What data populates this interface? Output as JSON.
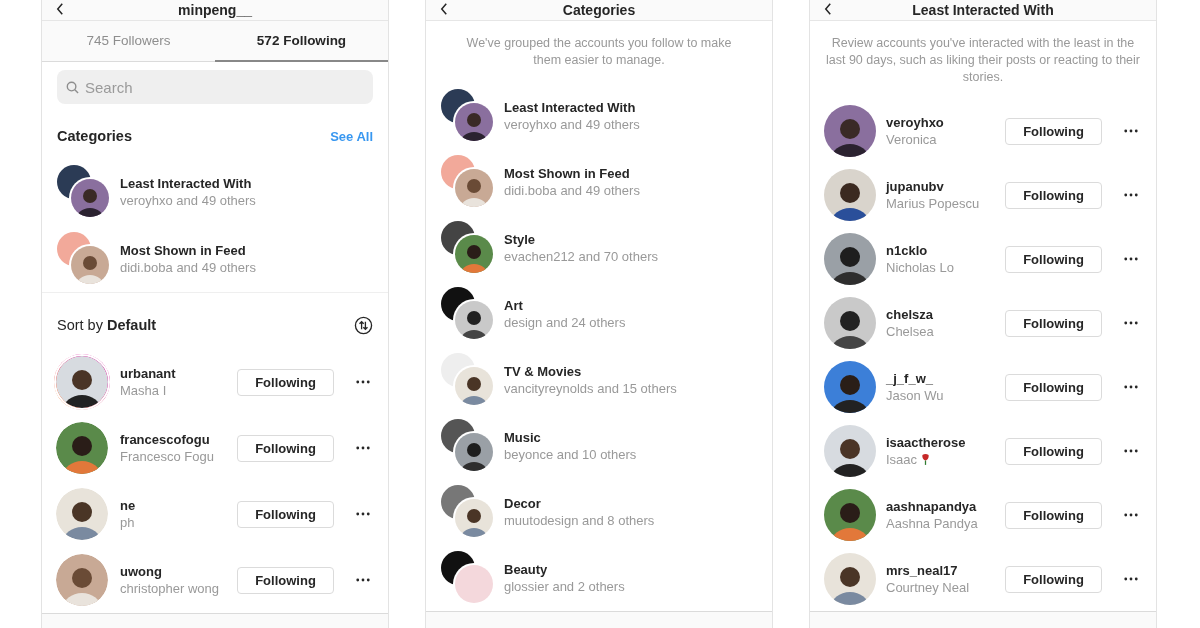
{
  "following_screen": {
    "title": "minpeng__",
    "tabs": [
      {
        "label": "745 Followers",
        "selected": false
      },
      {
        "label": "572 Following",
        "selected": true
      }
    ],
    "search": {
      "placeholder": "Search"
    },
    "categories_title": "Categories",
    "see_all": "See All",
    "categories": [
      {
        "name": "Least Interacted With",
        "summary": "veroyhxo and 49 others"
      },
      {
        "name": "Most Shown in Feed",
        "summary": "didi.boba and 49 others"
      }
    ],
    "sort_label": "Sort by **Default**",
    "accounts": [
      {
        "username": "urbanant",
        "name": "Masha I",
        "story": true,
        "button": "Following"
      },
      {
        "username": "francescofogu",
        "name": "Francesco Fogu",
        "story": false,
        "button": "Following"
      },
      {
        "username": "ne",
        "name": "ph",
        "story": false,
        "button": "Following"
      },
      {
        "username": "uwong",
        "name": "christopher wong",
        "story": false,
        "button": "Following"
      }
    ]
  },
  "categories_screen": {
    "title": "Categories",
    "description": "We've grouped the accounts you follow to make them easier to manage.",
    "categories": [
      {
        "name": "Least Interacted With",
        "summary": "veroyhxo and 49 others"
      },
      {
        "name": "Most Shown in Feed",
        "summary": "didi.boba and 49 others"
      },
      {
        "name": "Style",
        "summary": "evachen212 and 70 others"
      },
      {
        "name": "Art",
        "summary": "design and 24 others"
      },
      {
        "name": "TV & Movies",
        "summary": "vancityreynolds and 15 others"
      },
      {
        "name": "Music",
        "summary": "beyonce and 10 others"
      },
      {
        "name": "Decor",
        "summary": "muutodesign and 8 others"
      },
      {
        "name": "Beauty",
        "summary": "glossier and 2 others"
      }
    ]
  },
  "least_interacted_screen": {
    "title": "Least Interacted With",
    "description": "Review accounts you've interacted with the least in the last 90 days, such as liking their posts or reacting to their stories.",
    "accounts": [
      {
        "username": "veroyhxo",
        "name": "Veronica",
        "rose": false,
        "button": "Following"
      },
      {
        "username": "jupanubv",
        "name": "Marius Popescu",
        "rose": false,
        "button": "Following"
      },
      {
        "username": "n1cklo",
        "name": "Nicholas Lo",
        "rose": false,
        "button": "Following"
      },
      {
        "username": "chelsza",
        "name": "Chelsea",
        "rose": false,
        "button": "Following"
      },
      {
        "username": "_j_f_w_",
        "name": "Jason Wu",
        "rose": false,
        "button": "Following"
      },
      {
        "username": "isaactherose",
        "name": "Isaac",
        "rose": true,
        "button": "Following"
      },
      {
        "username": "aashnapandya",
        "name": "Aashna Pandya",
        "rose": false,
        "button": "Following"
      },
      {
        "username": "mrs_neal17",
        "name": "Courtney Neal",
        "rose": false,
        "button": "Following"
      }
    ]
  }
}
